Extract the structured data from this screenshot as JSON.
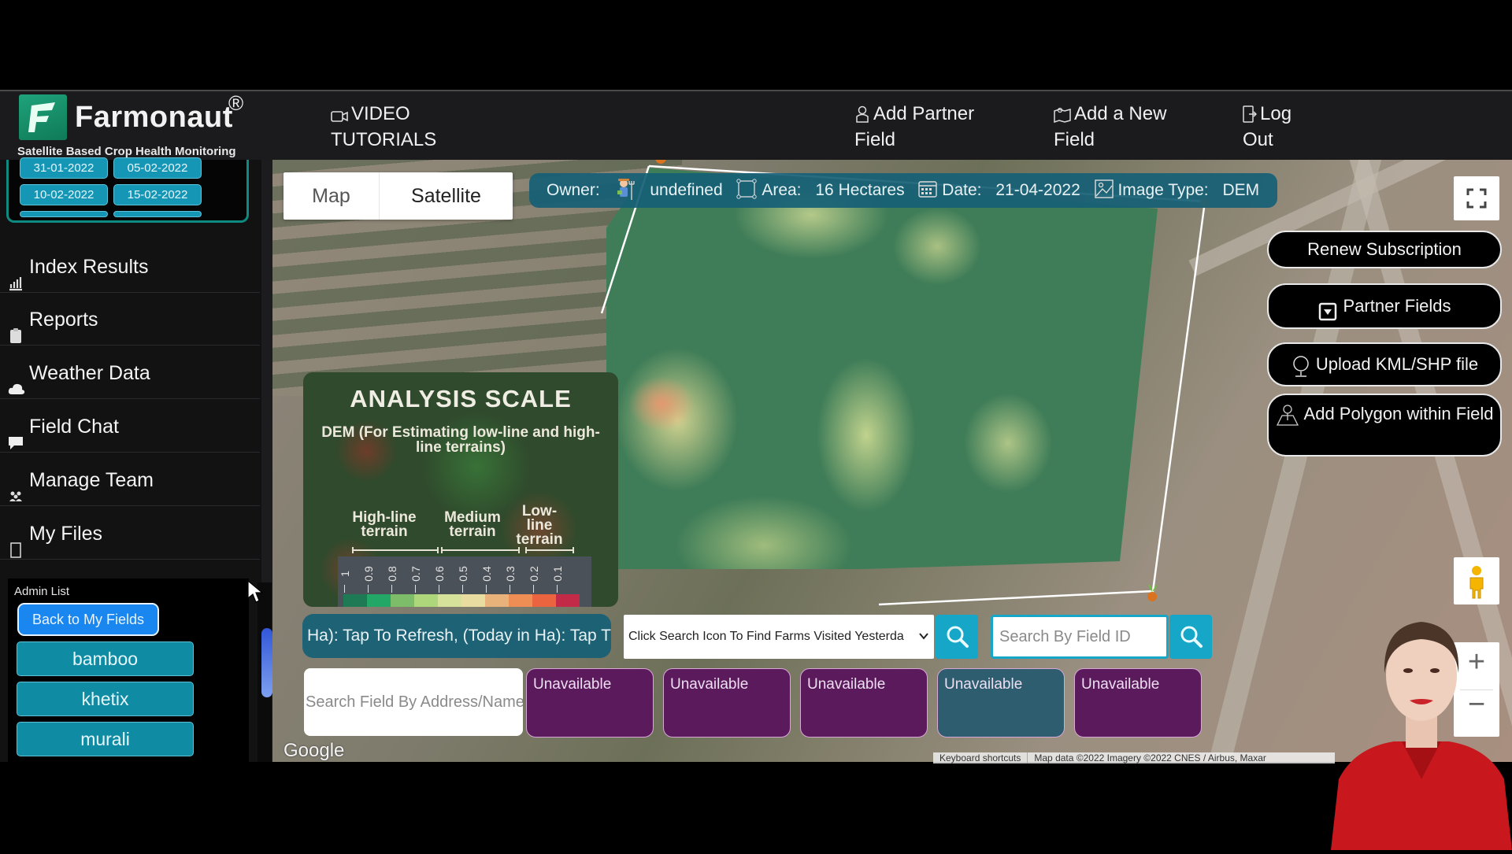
{
  "header": {
    "brand": "Farmonaut",
    "registered_mark": "®",
    "tagline": "Satellite Based Crop Health Monitoring",
    "nav": [
      {
        "icon": "video-icon",
        "line1": "VIDEO",
        "line2": "TUTORIALS"
      },
      {
        "icon": "partner-icon",
        "line1": "Add Partner",
        "line2": "Field"
      },
      {
        "icon": "map-field-icon",
        "line1": "Add a New",
        "line2": "Field"
      },
      {
        "icon": "logout-icon",
        "line1": "Log",
        "line2": "Out"
      }
    ]
  },
  "sidebar": {
    "dates": [
      "31-01-2022",
      "05-02-2022",
      "10-02-2022",
      "15-02-2022"
    ],
    "items": [
      {
        "icon": "chart-icon",
        "label": "Index Results"
      },
      {
        "icon": "report-icon",
        "label": "Reports"
      },
      {
        "icon": "cloud-icon",
        "label": "Weather Data"
      },
      {
        "icon": "chat-icon",
        "label": "Field Chat"
      },
      {
        "icon": "team-icon",
        "label": "Manage Team"
      },
      {
        "icon": "file-icon",
        "label": "My Files"
      }
    ],
    "admin": {
      "label": "Admin List",
      "back_button": "Back to My Fields",
      "users": [
        "bamboo",
        "khetix",
        "murali"
      ]
    }
  },
  "map": {
    "type_toggle": {
      "map": "Map",
      "satellite": "Satellite",
      "selected": "Satellite"
    },
    "info_bar": {
      "owner_label": "Owner:",
      "owner_value": "undefined",
      "area_label": "Area:",
      "area_value": "16 Hectares",
      "date_label": "Date:",
      "date_value": "21-04-2022",
      "image_type_label": "Image Type:",
      "image_type_value": "DEM"
    },
    "right_buttons": [
      {
        "label": "Renew Subscription",
        "icon": ""
      },
      {
        "label": "Partner Fields",
        "icon": "dropdown-box-icon"
      },
      {
        "label": "Upload KML/SHP file",
        "icon": "globe-icon"
      },
      {
        "label": "Add Polygon within Field",
        "icon": "polygon-map-icon"
      }
    ],
    "analysis_scale": {
      "title": "ANALYSIS SCALE",
      "subtitle": "DEM (For Estimating low-line and high-line terrains)",
      "terrains": [
        "High-line terrain",
        "Medium terrain",
        "Low-line terrain"
      ],
      "ticks": [
        "1",
        "0.9",
        "0.8",
        "0.7",
        "0.6",
        "0.5",
        "0.4",
        "0.3",
        "0.2",
        "0.1"
      ],
      "colors": [
        "#1e7a55",
        "#23a766",
        "#7dbd6a",
        "#aed67a",
        "#d6e29a",
        "#e9dca0",
        "#e8b27a",
        "#ee8e55",
        "#e9643f",
        "#c22a48"
      ]
    },
    "refresh_text": "Ha): Tap To Refresh, (Today in Ha): Tap T",
    "farm_select": {
      "selected": "Click Search Icon To Find Farms Visited Yesterda"
    },
    "field_id_placeholder": "Search By Field ID",
    "address_placeholder": "Search Field By Address/Name",
    "tiles": [
      {
        "label": "Unavailable",
        "color": "#5b1a5c"
      },
      {
        "label": "Unavailable",
        "color": "#5b1a5c"
      },
      {
        "label": "Unavailable",
        "color": "#5b1a5c"
      },
      {
        "label": "Unavailable",
        "color": "#2f5d70"
      },
      {
        "label": "Unavailable",
        "color": "#5b1a5c"
      }
    ],
    "google_label": "Google",
    "attribution": {
      "shortcuts": "Keyboard shortcuts",
      "data": "Map data ©2022 Imagery ©2022 CNES / Airbus, Maxar"
    },
    "zoom_in": "+",
    "zoom_out": "−"
  }
}
